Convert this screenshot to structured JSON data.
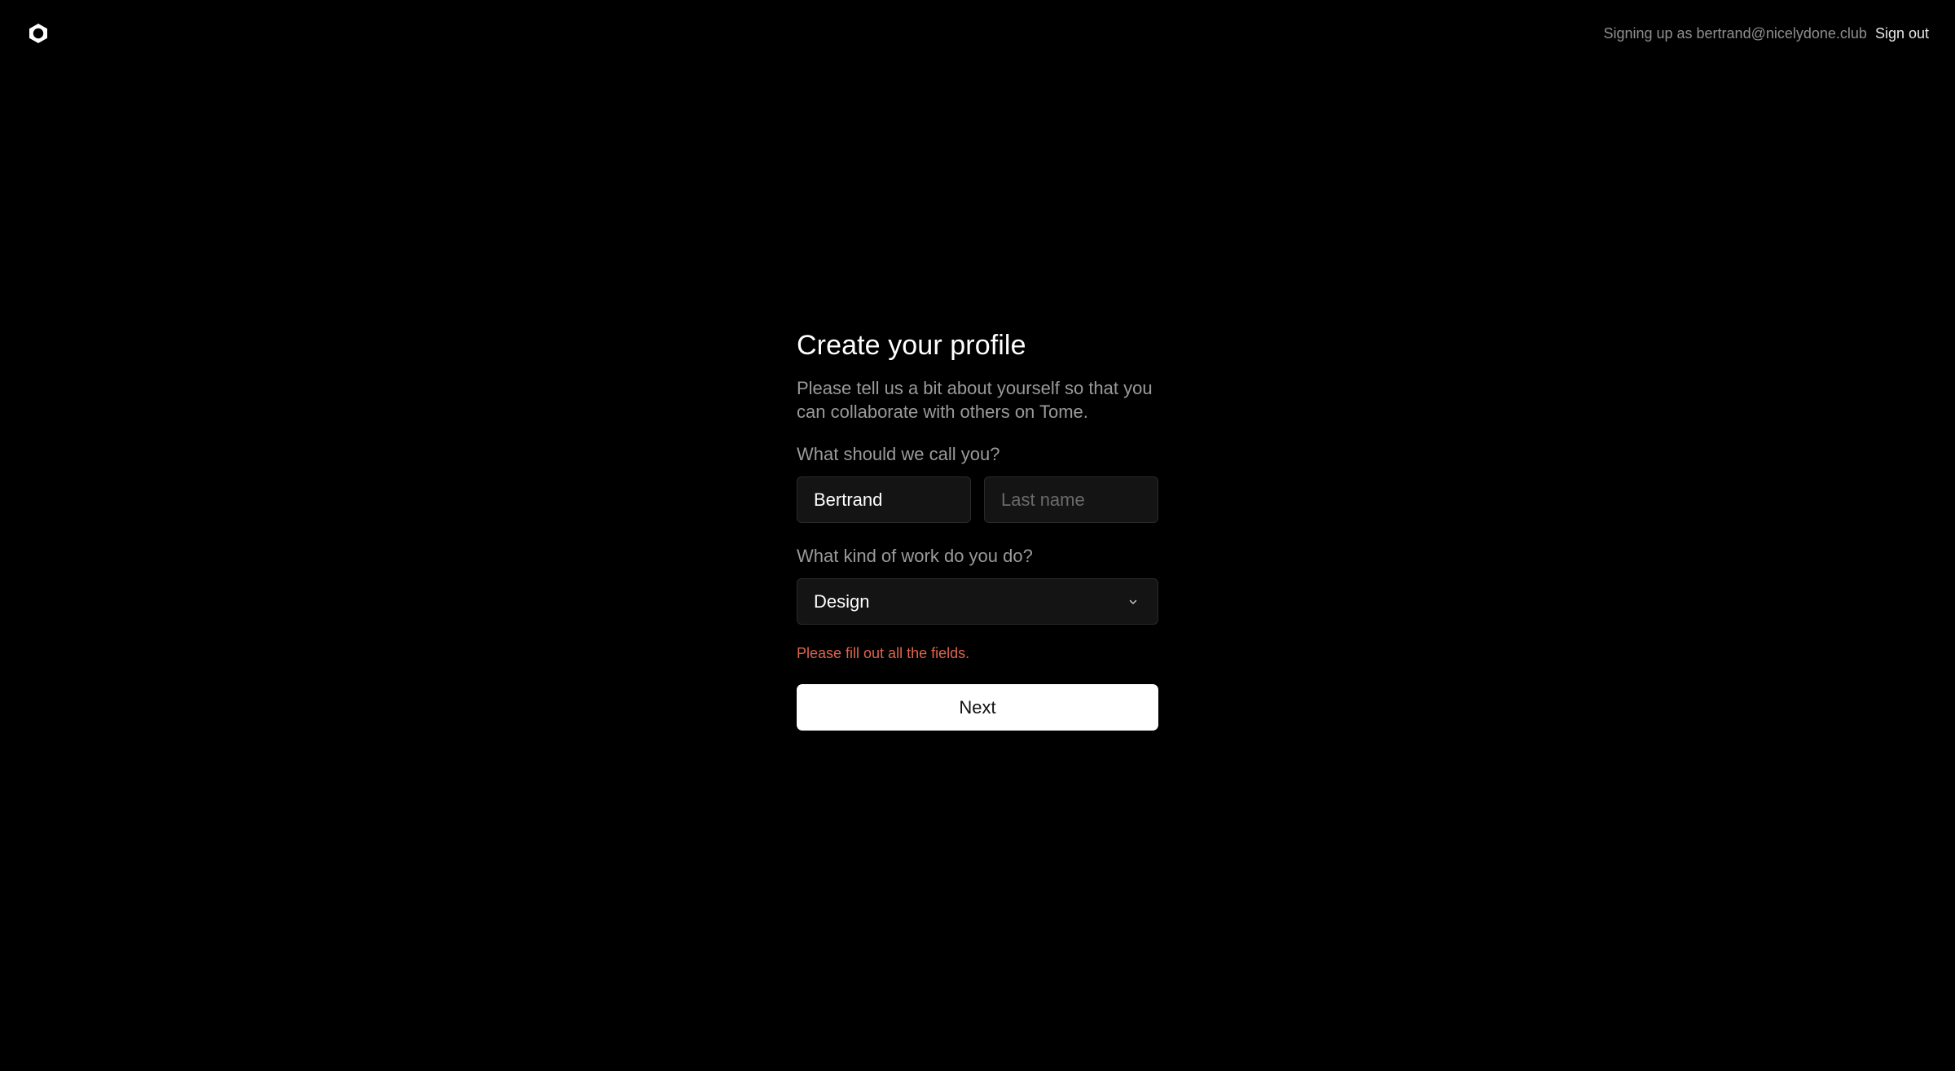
{
  "header": {
    "logo_icon": "tome-logo-icon",
    "signed_in_text": "Signing up as bertrand@nicelydone.club",
    "sign_out_label": "Sign out"
  },
  "form": {
    "title": "Create your profile",
    "subtitle": "Please tell us a bit about yourself so that you can collaborate with others on Tome.",
    "name_label": "What should we call you?",
    "first_name_value": "Bertrand",
    "last_name_placeholder": "Last name",
    "last_name_value": "",
    "work_label": "What kind of work do you do?",
    "work_selected": "Design",
    "work_icon": "chevron-down-icon",
    "error_message": "Please fill out all the fields.",
    "next_label": "Next"
  },
  "colors": {
    "background": "#000000",
    "error": "#e0644f",
    "button_bg": "#ffffff"
  }
}
